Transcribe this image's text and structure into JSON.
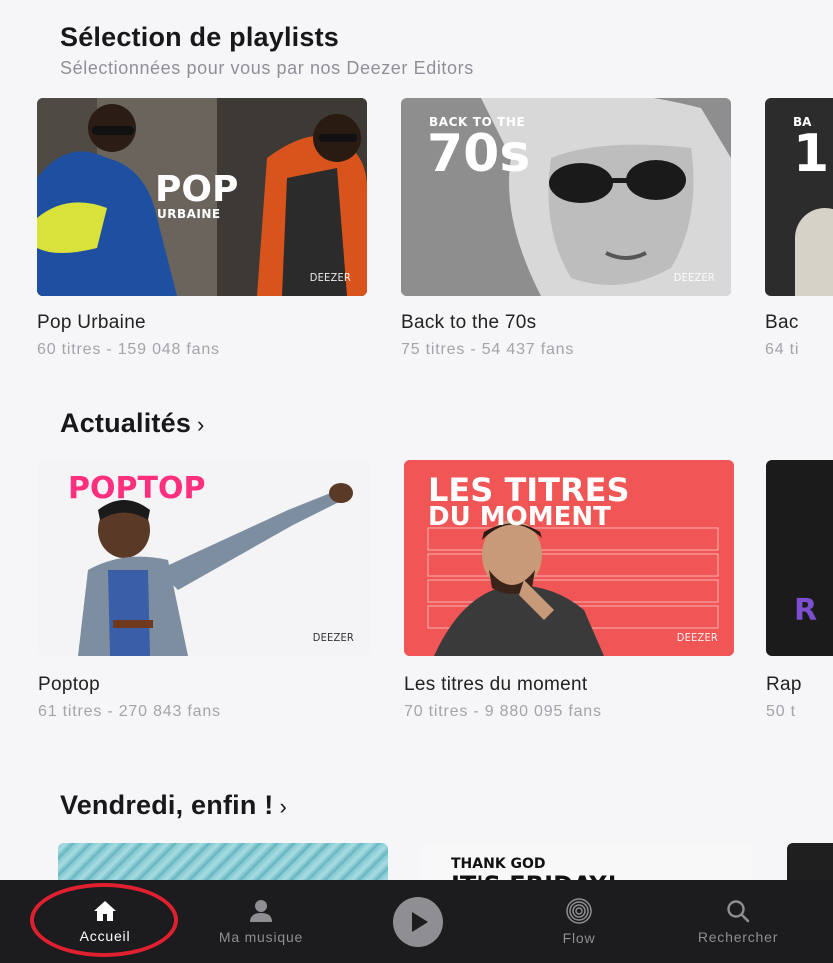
{
  "sections": {
    "playlists": {
      "title": "Sélection de playlists",
      "subtitle": "Sélectionnées pour vous par nos Deezer Editors",
      "cards": [
        {
          "title": "Pop Urbaine",
          "meta": "60 titres - 159 048 fans",
          "cover_text_1": "POP",
          "cover_text_2": "URBAINE",
          "brand": "DEEZER"
        },
        {
          "title": "Back to the 70s",
          "meta": "75 titres - 54 437 fans",
          "cover_text_1": "BACK TO THE",
          "cover_text_2": "70s",
          "brand": "DEEZER"
        },
        {
          "title": "Bac",
          "meta": "64 ti",
          "cover_text_1": "BA",
          "cover_text_2": "1"
        }
      ]
    },
    "actualites": {
      "title": "Actualités",
      "chevron": "›",
      "cards": [
        {
          "title": "Poptop",
          "meta": "61 titres - 270 843 fans",
          "cover_text_1": "POPTOP",
          "brand": "DEEZER"
        },
        {
          "title": "Les titres du moment",
          "meta": "70 titres - 9 880 095 fans",
          "cover_text_1": "LES TITRES",
          "cover_text_2": "DU MOMENT",
          "brand": "DEEZER"
        },
        {
          "title": "Rap",
          "meta": "50 t",
          "cover_text_1": "R"
        }
      ]
    },
    "vendredi": {
      "title": "Vendredi, enfin !",
      "chevron": "›",
      "cards": [
        {
          "cover_text_1": ""
        },
        {
          "cover_text_1": "THANK GOD",
          "cover_text_2": "IT'S FRIDAY!"
        },
        {
          "cover_text_1": ""
        }
      ]
    }
  },
  "nav": {
    "items": [
      {
        "label": "Accueil",
        "icon": "home-icon",
        "active": true
      },
      {
        "label": "Ma musique",
        "icon": "user-icon",
        "active": false
      },
      {
        "label": "",
        "icon": "play-icon",
        "active": false
      },
      {
        "label": "Flow",
        "icon": "flow-icon",
        "active": false
      },
      {
        "label": "Rechercher",
        "icon": "search-icon",
        "active": false
      }
    ]
  },
  "colors": {
    "accent_ring": "#e0202f",
    "nav_bg": "#1c1c1e",
    "page_bg": "#f6f6f8",
    "poptop_pink": "#ff2f7f",
    "titres_red": "#f05656"
  }
}
